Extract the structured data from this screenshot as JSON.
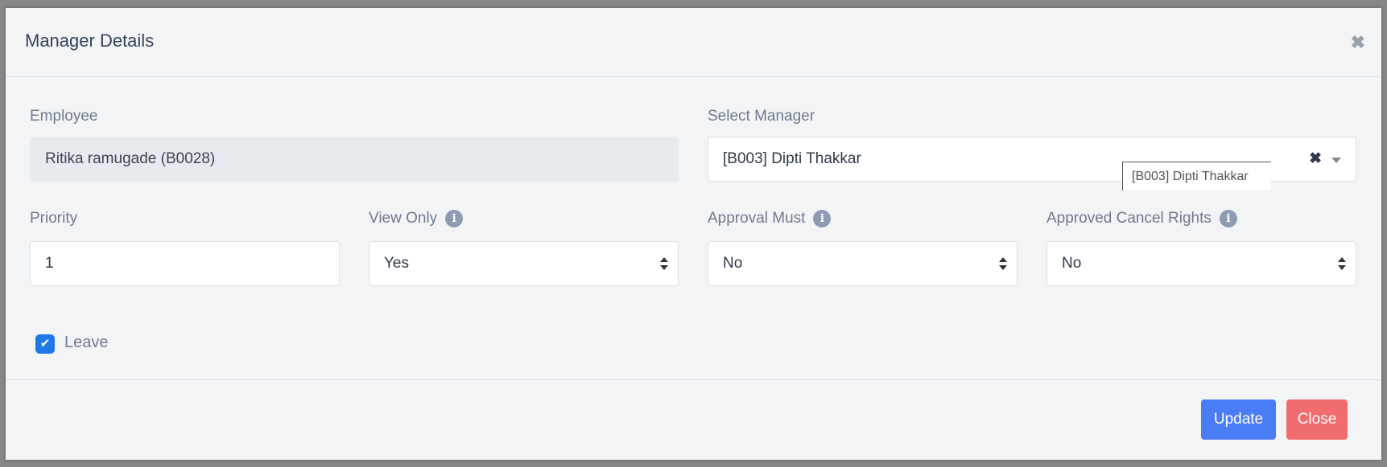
{
  "modal": {
    "title": "Manager Details",
    "close_icon": "close-icon"
  },
  "form": {
    "employee": {
      "label": "Employee",
      "value": "Ritika ramugade (B0028)"
    },
    "manager": {
      "label": "Select Manager",
      "value": "[B003] Dipti Thakkar",
      "tooltip": "[B003] Dipti Thakkar",
      "clear_glyph": "✖"
    },
    "priority": {
      "label": "Priority",
      "value": "1"
    },
    "view_only": {
      "label": "View Only",
      "value": "Yes",
      "info_glyph": "i"
    },
    "approval_must": {
      "label": "Approval Must",
      "value": "No",
      "info_glyph": "i"
    },
    "approved_cancel_rights": {
      "label": "Approved Cancel Rights",
      "value": "No",
      "info_glyph": "i"
    },
    "leave": {
      "label": "Leave",
      "checked": true,
      "check_glyph": "✔"
    }
  },
  "footer": {
    "update_label": "Update",
    "close_label": "Close"
  },
  "colors": {
    "primary": "#4a7cf5",
    "danger": "#f16c6e",
    "checkbox": "#1f77e8"
  }
}
